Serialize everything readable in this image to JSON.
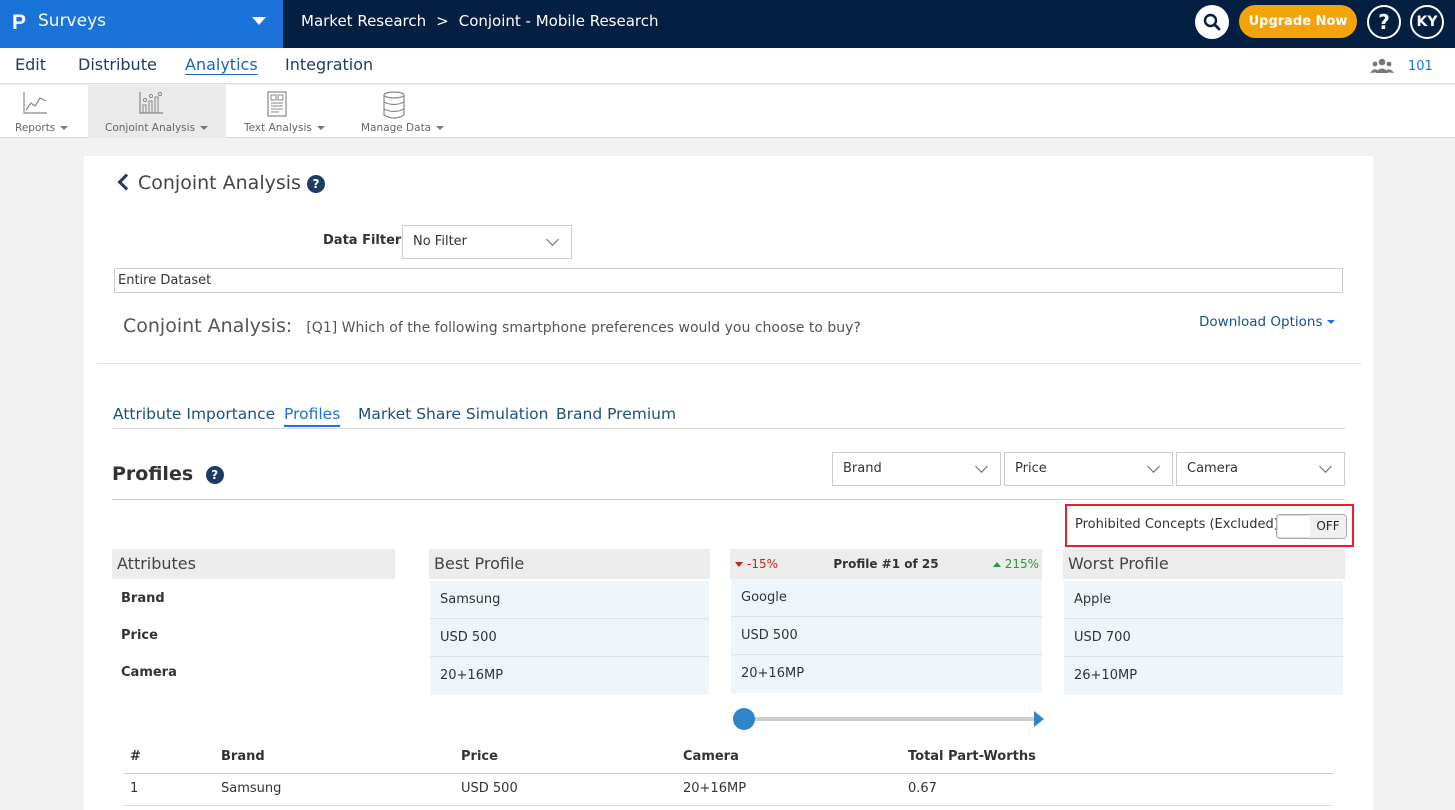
{
  "topbar": {
    "logo": "P",
    "app_name": "Surveys",
    "breadcrumb": [
      "Market Research",
      "Conjoint - Mobile Research"
    ],
    "breadcrumb_sep": ">",
    "upgrade_label": "Upgrade Now",
    "help_label": "?",
    "avatar_initials": "KY"
  },
  "menu": {
    "items": [
      "Edit",
      "Distribute",
      "Analytics",
      "Integration"
    ],
    "active": "Analytics",
    "users_count": "101"
  },
  "toolbar": {
    "items": [
      "Reports",
      "Conjoint Analysis",
      "Text Analysis",
      "Manage Data"
    ],
    "active": "Conjoint Analysis"
  },
  "page": {
    "title": "Conjoint Analysis",
    "help": "?",
    "data_filter_label": "Data Filter",
    "data_filter_value": "No Filter",
    "dataset_value": "Entire Dataset",
    "section_title": "Conjoint Analysis:",
    "question": "[Q1] Which of the following smartphone preferences would you choose to buy?",
    "download_label": "Download Options"
  },
  "tabs": {
    "items": [
      "Attribute Importance",
      "Profiles",
      "Market Share Simulation",
      "Brand Premium"
    ],
    "active": "Profiles"
  },
  "profiles": {
    "heading": "Profiles",
    "filters": [
      "Brand",
      "Price",
      "Camera"
    ],
    "prohibited_label": "Prohibited Concepts (Excluded)",
    "prohibited_state": "OFF",
    "attributes_header": "Attributes",
    "attributes": [
      "Brand",
      "Price",
      "Camera"
    ],
    "best_header": "Best Profile",
    "best": [
      "Samsung",
      "USD 500",
      "20+16MP"
    ],
    "current": {
      "down": "-15%",
      "title": "Profile #1 of 25",
      "up": "215%",
      "values": [
        "Google",
        "USD 500",
        "20+16MP"
      ]
    },
    "worst_header": "Worst Profile",
    "worst": [
      "Apple",
      "USD 700",
      "26+10MP"
    ],
    "slider_position": 1,
    "slider_total": 25
  },
  "table": {
    "headers": [
      "#",
      "Brand",
      "Price",
      "Camera",
      "Total Part-Worths"
    ],
    "rows": [
      [
        "1",
        "Samsung",
        "USD 500",
        "20+16MP",
        "0.67"
      ]
    ]
  }
}
